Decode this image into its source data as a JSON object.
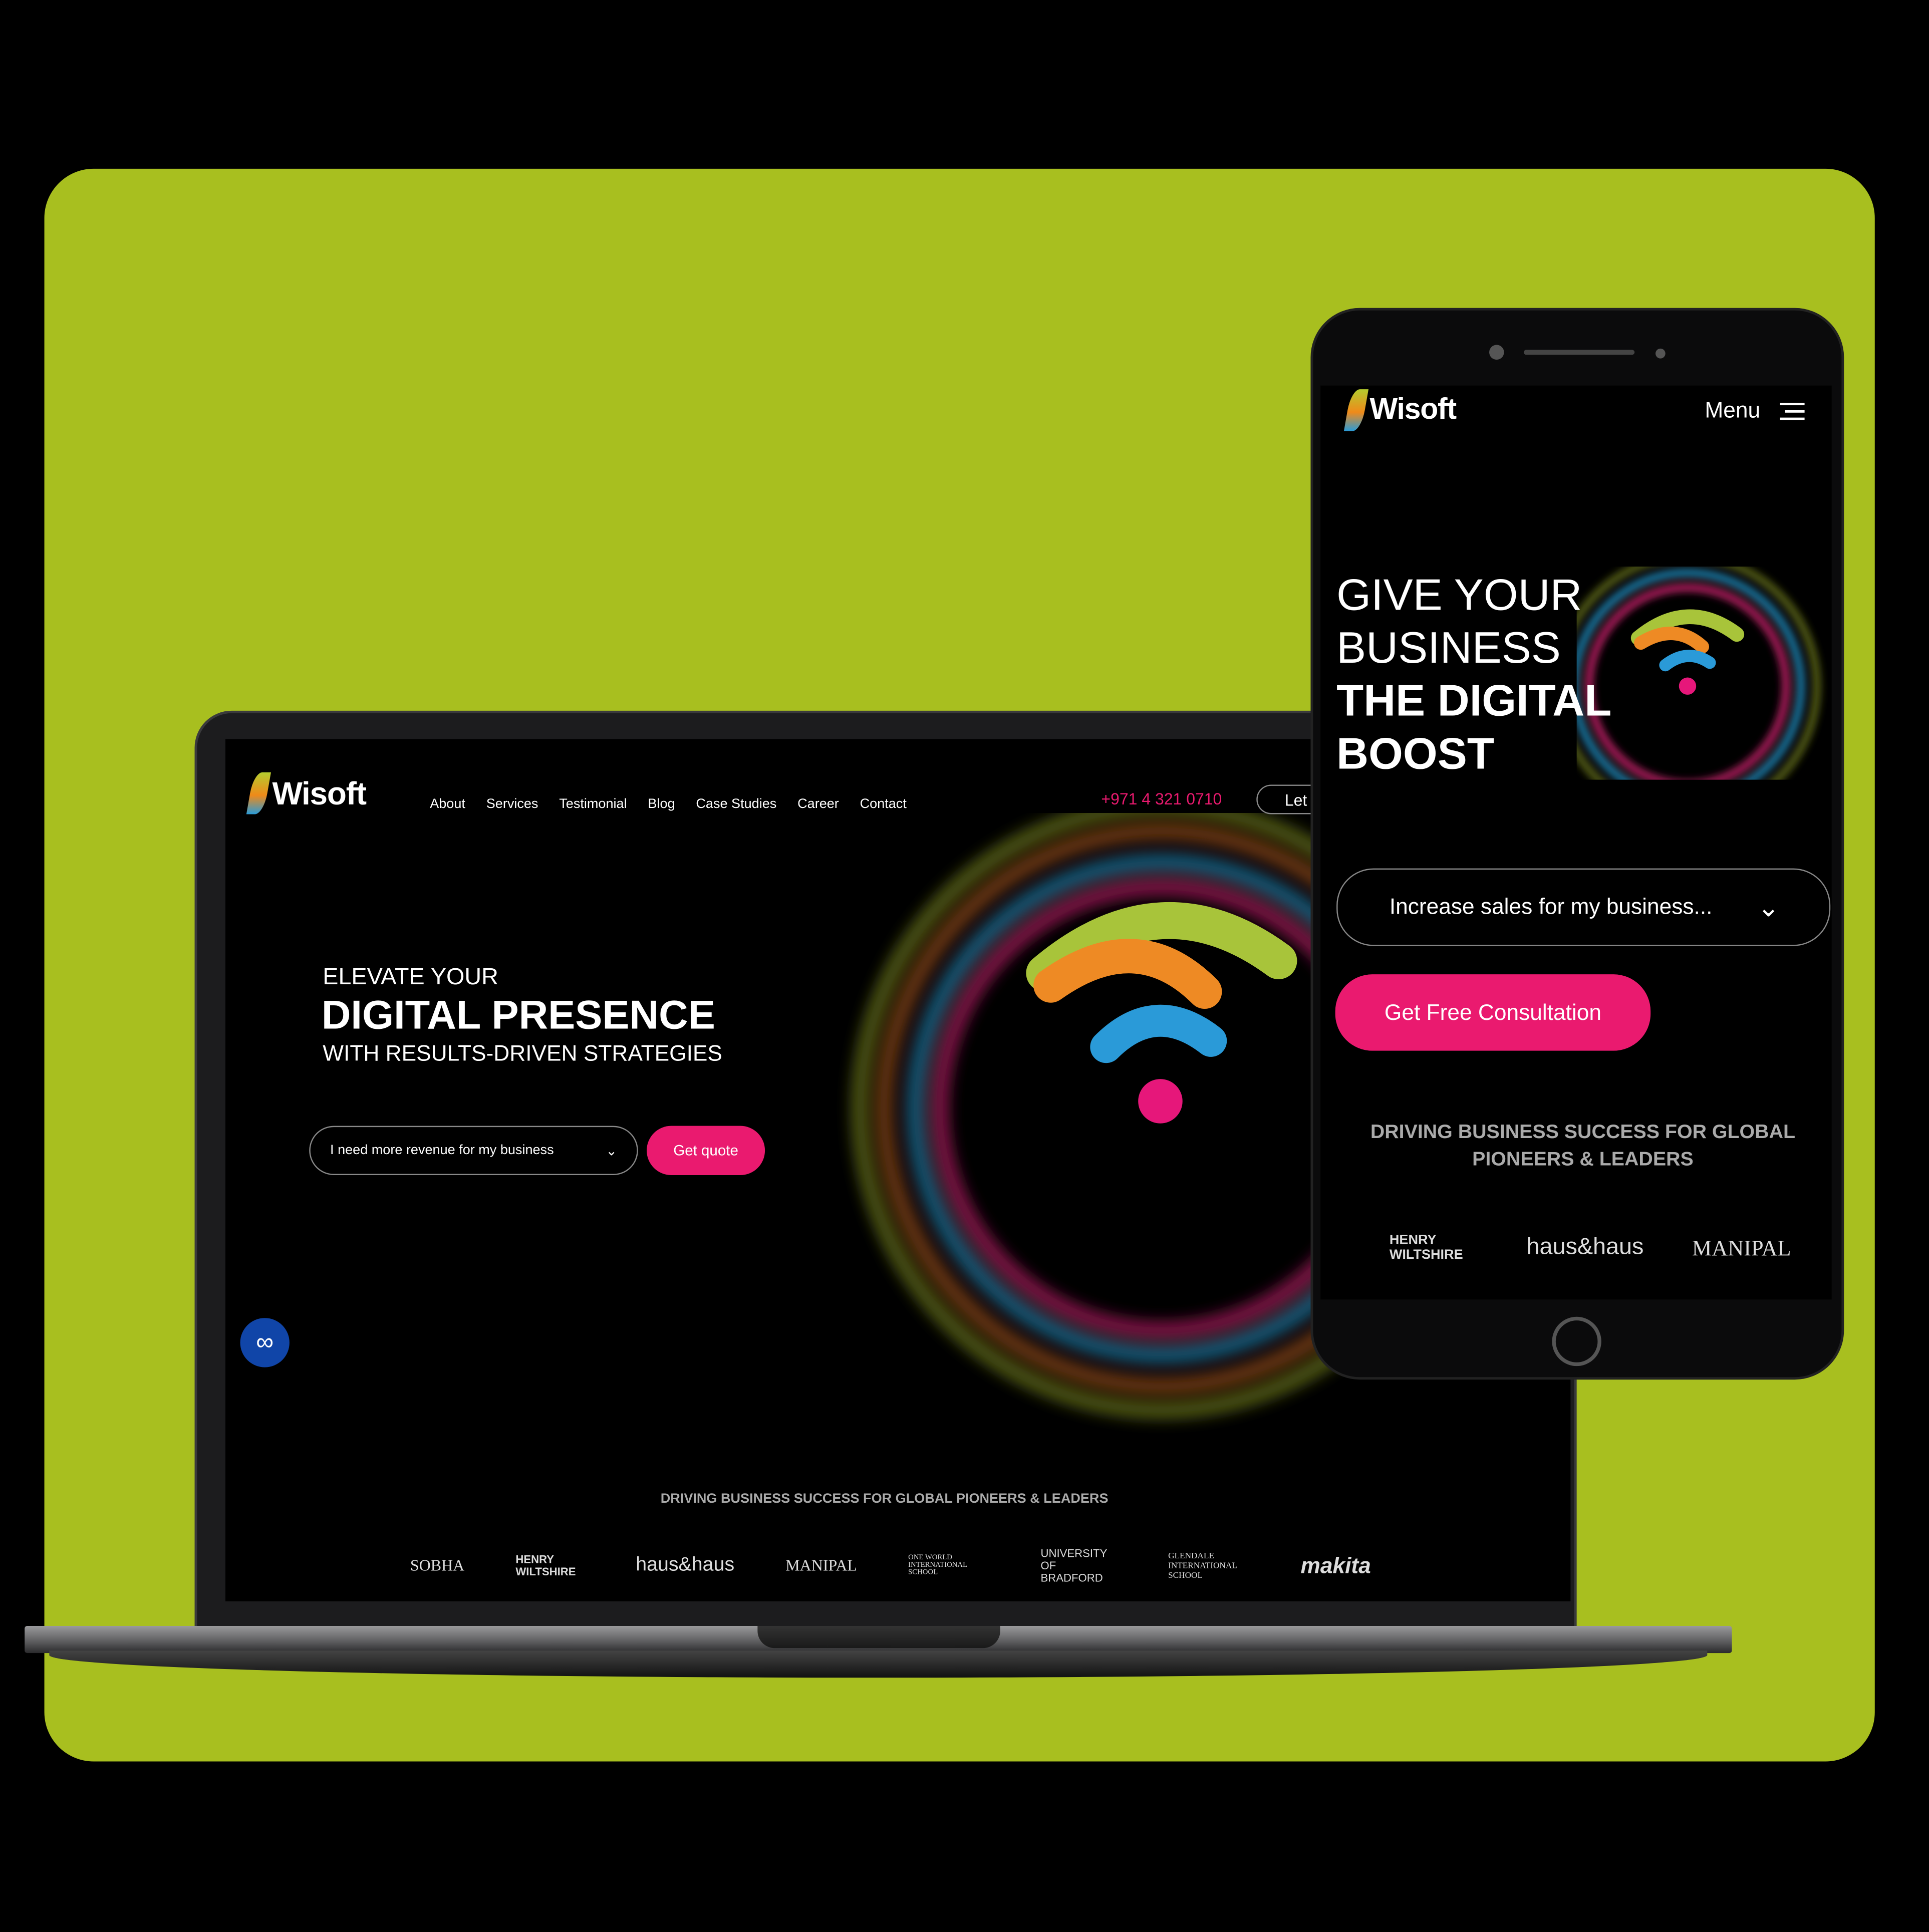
{
  "colors": {
    "background": "#a8bf1f",
    "accent": "#ea1a6f",
    "link_badge": "#1045a8"
  },
  "desktop": {
    "logo": "Wisoft",
    "nav": [
      "About",
      "Services",
      "Testimonial",
      "Blog",
      "Case Studies",
      "Career",
      "Contact"
    ],
    "phone": "+971 4 321 0710",
    "cta_partial": "Let",
    "hero": {
      "line1": "ELEVATE YOUR",
      "line2": "DIGITAL PRESENCE",
      "line3": "WITH RESULTS-DRIVEN STRATEGIES"
    },
    "dropdown": "I need more revenue for my business",
    "get_quote": "Get quote",
    "link_icon": "link-icon",
    "tagline": "DRIVING BUSINESS SUCCESS FOR GLOBAL PIONEERS & LEADERS",
    "clients": [
      "SOBHA",
      "HENRY WILTSHIRE",
      "haus&haus",
      "MANIPAL",
      "ONE WORLD INTERNATIONAL SCHOOL",
      "UNIVERSITY OF BRADFORD",
      "GLENDALE INTERNATIONAL SCHOOL",
      "makita"
    ]
  },
  "mobile": {
    "logo": "Wisoft",
    "menu": "Menu",
    "hero": {
      "line1": "GIVE YOUR",
      "line2": "BUSINESS",
      "line3": "THE DIGITAL",
      "line4": "BOOST"
    },
    "dropdown": "Increase sales for my business...",
    "cta": "Get Free Consultation",
    "tagline": "DRIVING BUSINESS SUCCESS FOR GLOBAL PIONEERS & LEADERS",
    "clients": [
      "HENRY WILTSHIRE",
      "haus&haus",
      "MANIPAL"
    ]
  }
}
